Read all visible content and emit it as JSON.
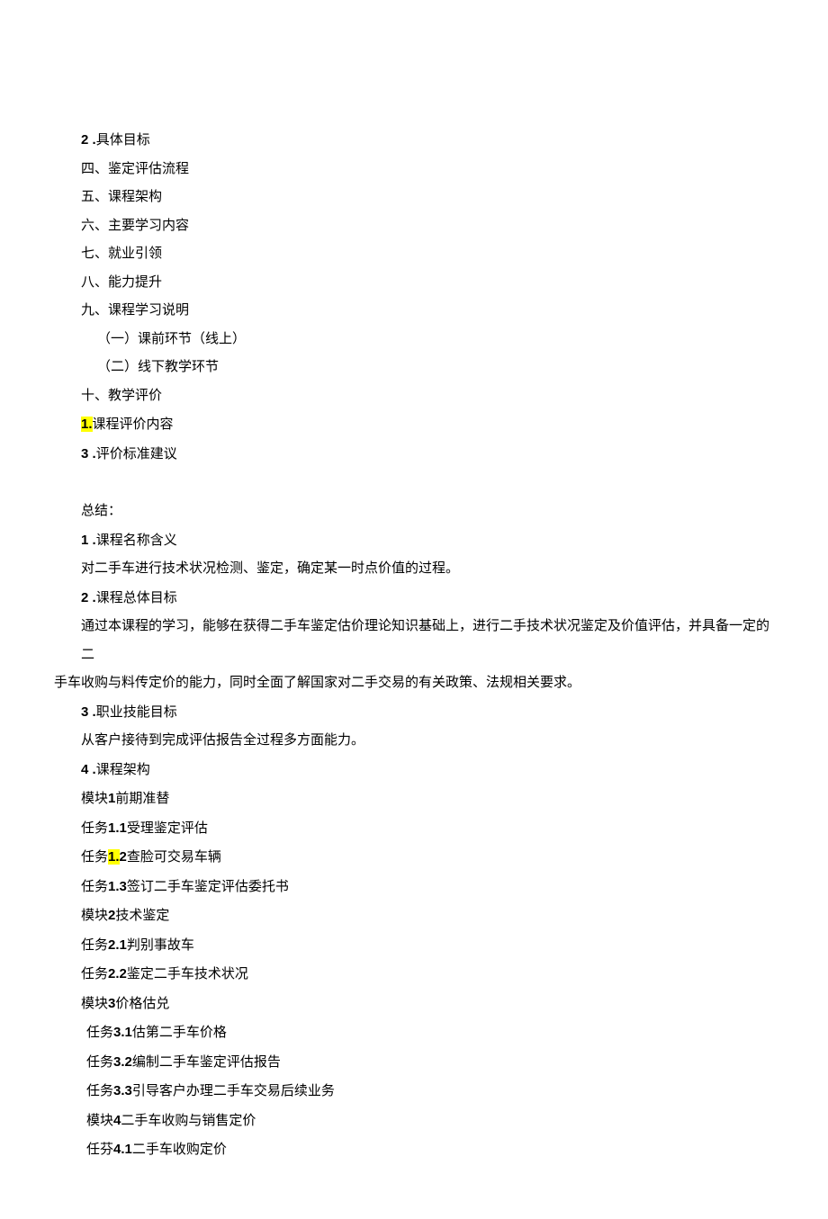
{
  "outline": {
    "item2": {
      "num": "2 .",
      "text": "具体目标"
    },
    "item_si": "四、鉴定评估流程",
    "item_wu": "五、课程架构",
    "item_liu": "六、主要学习内容",
    "item_qi": "七、就业引领",
    "item_ba": "八、能力提升",
    "item_jiu": "九、课程学习说明",
    "item_jiu_1": "（一）课前环节（线上）",
    "item_jiu_2": "（二）线下教学环节",
    "item_shi": "十、教学评价",
    "item_1_num": "1.",
    "item_1_text": "课程评价内容",
    "item_3_num": "3 .",
    "item_3_text": "评价标准建议"
  },
  "summary": {
    "heading": "总结：",
    "s1_num": "1 .",
    "s1_title": "课程名称含义",
    "s1_body": "对二手车进行技术状况检测、鉴定，确定某一时点价值的过程。",
    "s2_num": "2 .",
    "s2_title": "课程总体目标",
    "s2_body_a": "通过本课程的学习，能够在获得二手车鉴定估价理论知识基础上，进行二手技术状况鉴定及价值评估，并具备一定的二",
    "s2_body_b": "手车收购与料传定价的能力，同时全面了解国家对二手交易的有关政策、法规相关要求。",
    "s3_num": "3 .",
    "s3_title": "职业技能目标",
    "s3_body": "从客户接待到完成评估报告全过程多方面能力。",
    "s4_num": "4 .",
    "s4_title": "课程架构",
    "m1": "模块",
    "m1_num": "1",
    "m1_text": "前期准替",
    "t11a": "任务",
    "t11_num": "1.1",
    "t11b": "受理鉴定评估",
    "t12a": "任务",
    "t12_num_a": "1.",
    "t12_num_b": "2",
    "t12b": "查脸可交易车辆",
    "t13a": "任务",
    "t13_num": "1.3",
    "t13b": "签订二手车鉴定评估委托书",
    "m2": "模块",
    "m2_num": "2",
    "m2_text": "技术鉴定",
    "t21a": "任务",
    "t21_num": "2.1",
    "t21b": "判别事故车",
    "t22a": "任务",
    "t22_num": "2.2",
    "t22b": "鉴定二手车技术状况",
    "m3": "模块",
    "m3_num": "3",
    "m3_text": "价格估兑",
    "t31a": "任务",
    "t31_num": "3.1",
    "t31b": "估第二手车价格",
    "t32a": "任务",
    "t32_num": "3.2",
    "t32b": "编制二手车鉴定评估报告",
    "t33a": "任务",
    "t33_num": "3.3",
    "t33b": "引导客户办理二手车交易后续业务",
    "m4": "模块",
    "m4_num": "4",
    "m4_text": "二手车收购与销售定价",
    "t41a": "任芬",
    "t41_num": "4.1",
    "t41b": "二手车收购定价"
  }
}
